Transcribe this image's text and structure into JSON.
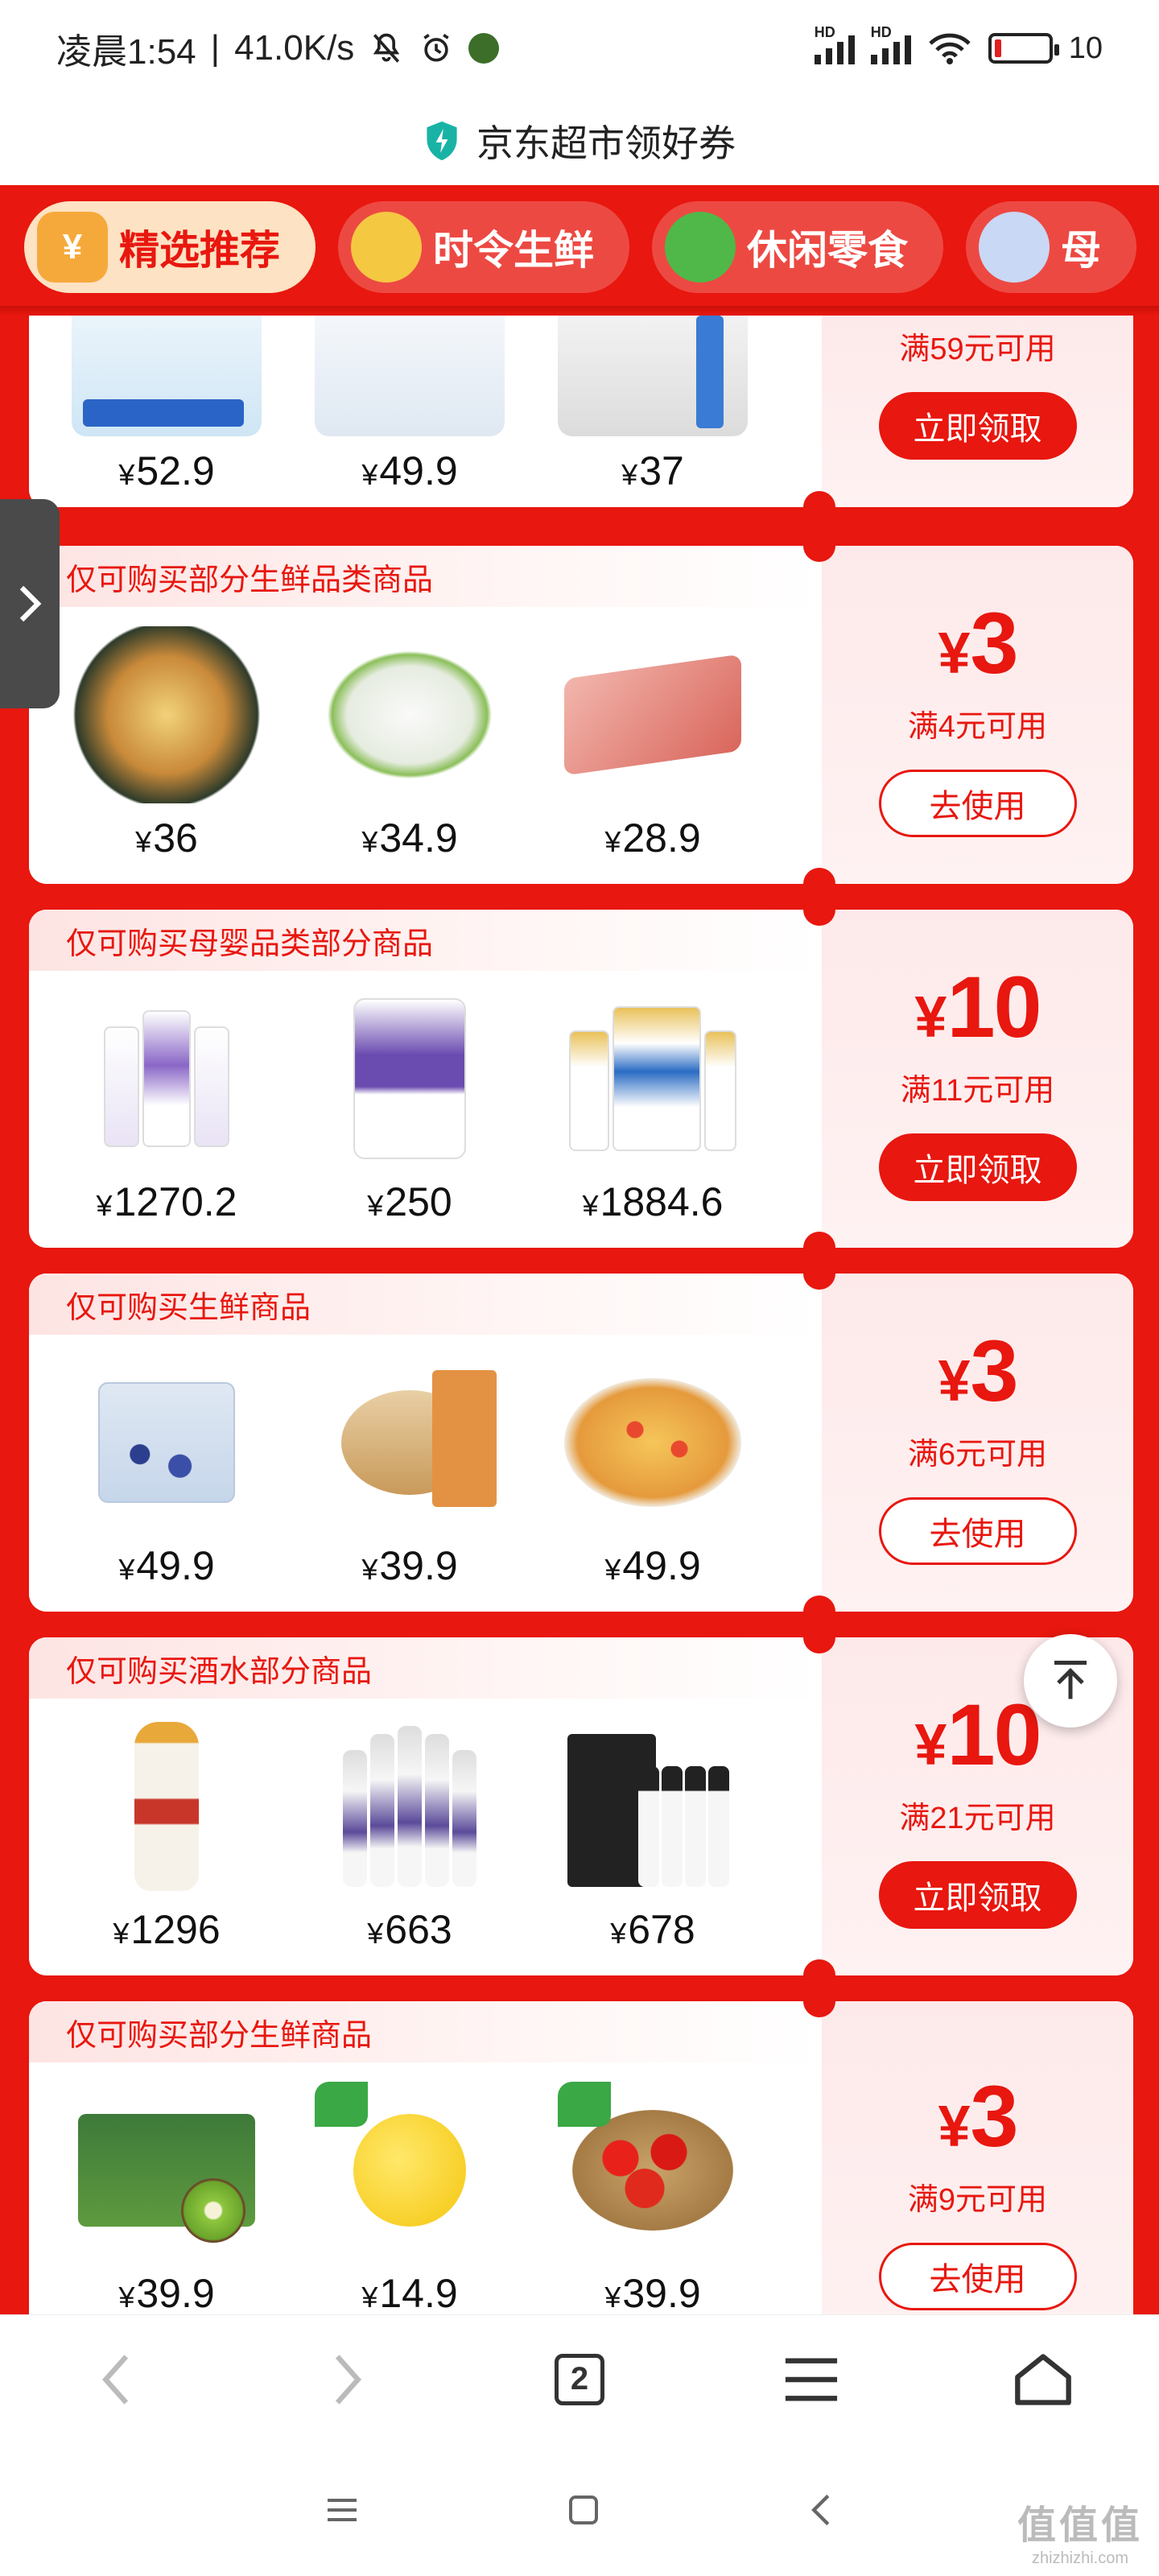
{
  "status_bar": {
    "time": "凌晨1:54",
    "speed": "41.0K/s",
    "hd1": "HD",
    "hd2": "HD",
    "battery": "10"
  },
  "title_bar": {
    "title": "京东超市领好券",
    "icon": "shield-icon",
    "icon_color": "#19b3a6"
  },
  "colors": {
    "brand_red": "#e8170f",
    "tab_active_bg": "#fde2c3"
  },
  "tabs": [
    {
      "label": "精选推荐",
      "active": true,
      "icon": "coupon-icon"
    },
    {
      "label": "时令生鲜",
      "active": false,
      "icon": "durian-icon"
    },
    {
      "label": "休闲零食",
      "active": false,
      "icon": "snack-icon"
    },
    {
      "label": "母",
      "active": false,
      "icon": "baby-bottle-icon"
    }
  ],
  "coupons": [
    {
      "restriction": "",
      "products": [
        {
          "price": "52.9",
          "name": "water-icon"
        },
        {
          "price": "49.9",
          "name": "water-icon"
        },
        {
          "price": "37",
          "name": "water-icon"
        }
      ],
      "amount": "",
      "condition": "满59元可用",
      "button": "立即领取",
      "button_type": "claim"
    },
    {
      "restriction": "仅可购买部分生鲜品类商品",
      "products": [
        {
          "price": "36"
        },
        {
          "price": "34.9"
        },
        {
          "price": "28.9"
        }
      ],
      "amount": "3",
      "condition": "满4元可用",
      "button": "去使用",
      "button_type": "use"
    },
    {
      "restriction": "仅可购买母婴品类部分商品",
      "products": [
        {
          "price": "1270.2"
        },
        {
          "price": "250"
        },
        {
          "price": "1884.6"
        }
      ],
      "amount": "10",
      "condition": "满11元可用",
      "button": "立即领取",
      "button_type": "claim"
    },
    {
      "restriction": "仅可购买生鲜商品",
      "products": [
        {
          "price": "49.9"
        },
        {
          "price": "39.9"
        },
        {
          "price": "49.9"
        }
      ],
      "amount": "3",
      "condition": "满6元可用",
      "button": "去使用",
      "button_type": "use"
    },
    {
      "restriction": "仅可购买酒水部分商品",
      "products": [
        {
          "price": "1296"
        },
        {
          "price": "663"
        },
        {
          "price": "678"
        }
      ],
      "amount": "10",
      "condition": "满21元可用",
      "button": "立即领取",
      "button_type": "claim"
    },
    {
      "restriction": "仅可购买部分生鲜商品",
      "products": [
        {
          "price": "39.9"
        },
        {
          "price": "14.9"
        },
        {
          "price": "39.9"
        }
      ],
      "amount": "3",
      "condition": "满9元可用",
      "button": "去使用",
      "button_type": "use"
    }
  ],
  "currency": "¥",
  "browser_bar": {
    "tab_count": "2"
  },
  "watermark": {
    "line1": "值值值",
    "line2": "zhizhizhi.com"
  }
}
